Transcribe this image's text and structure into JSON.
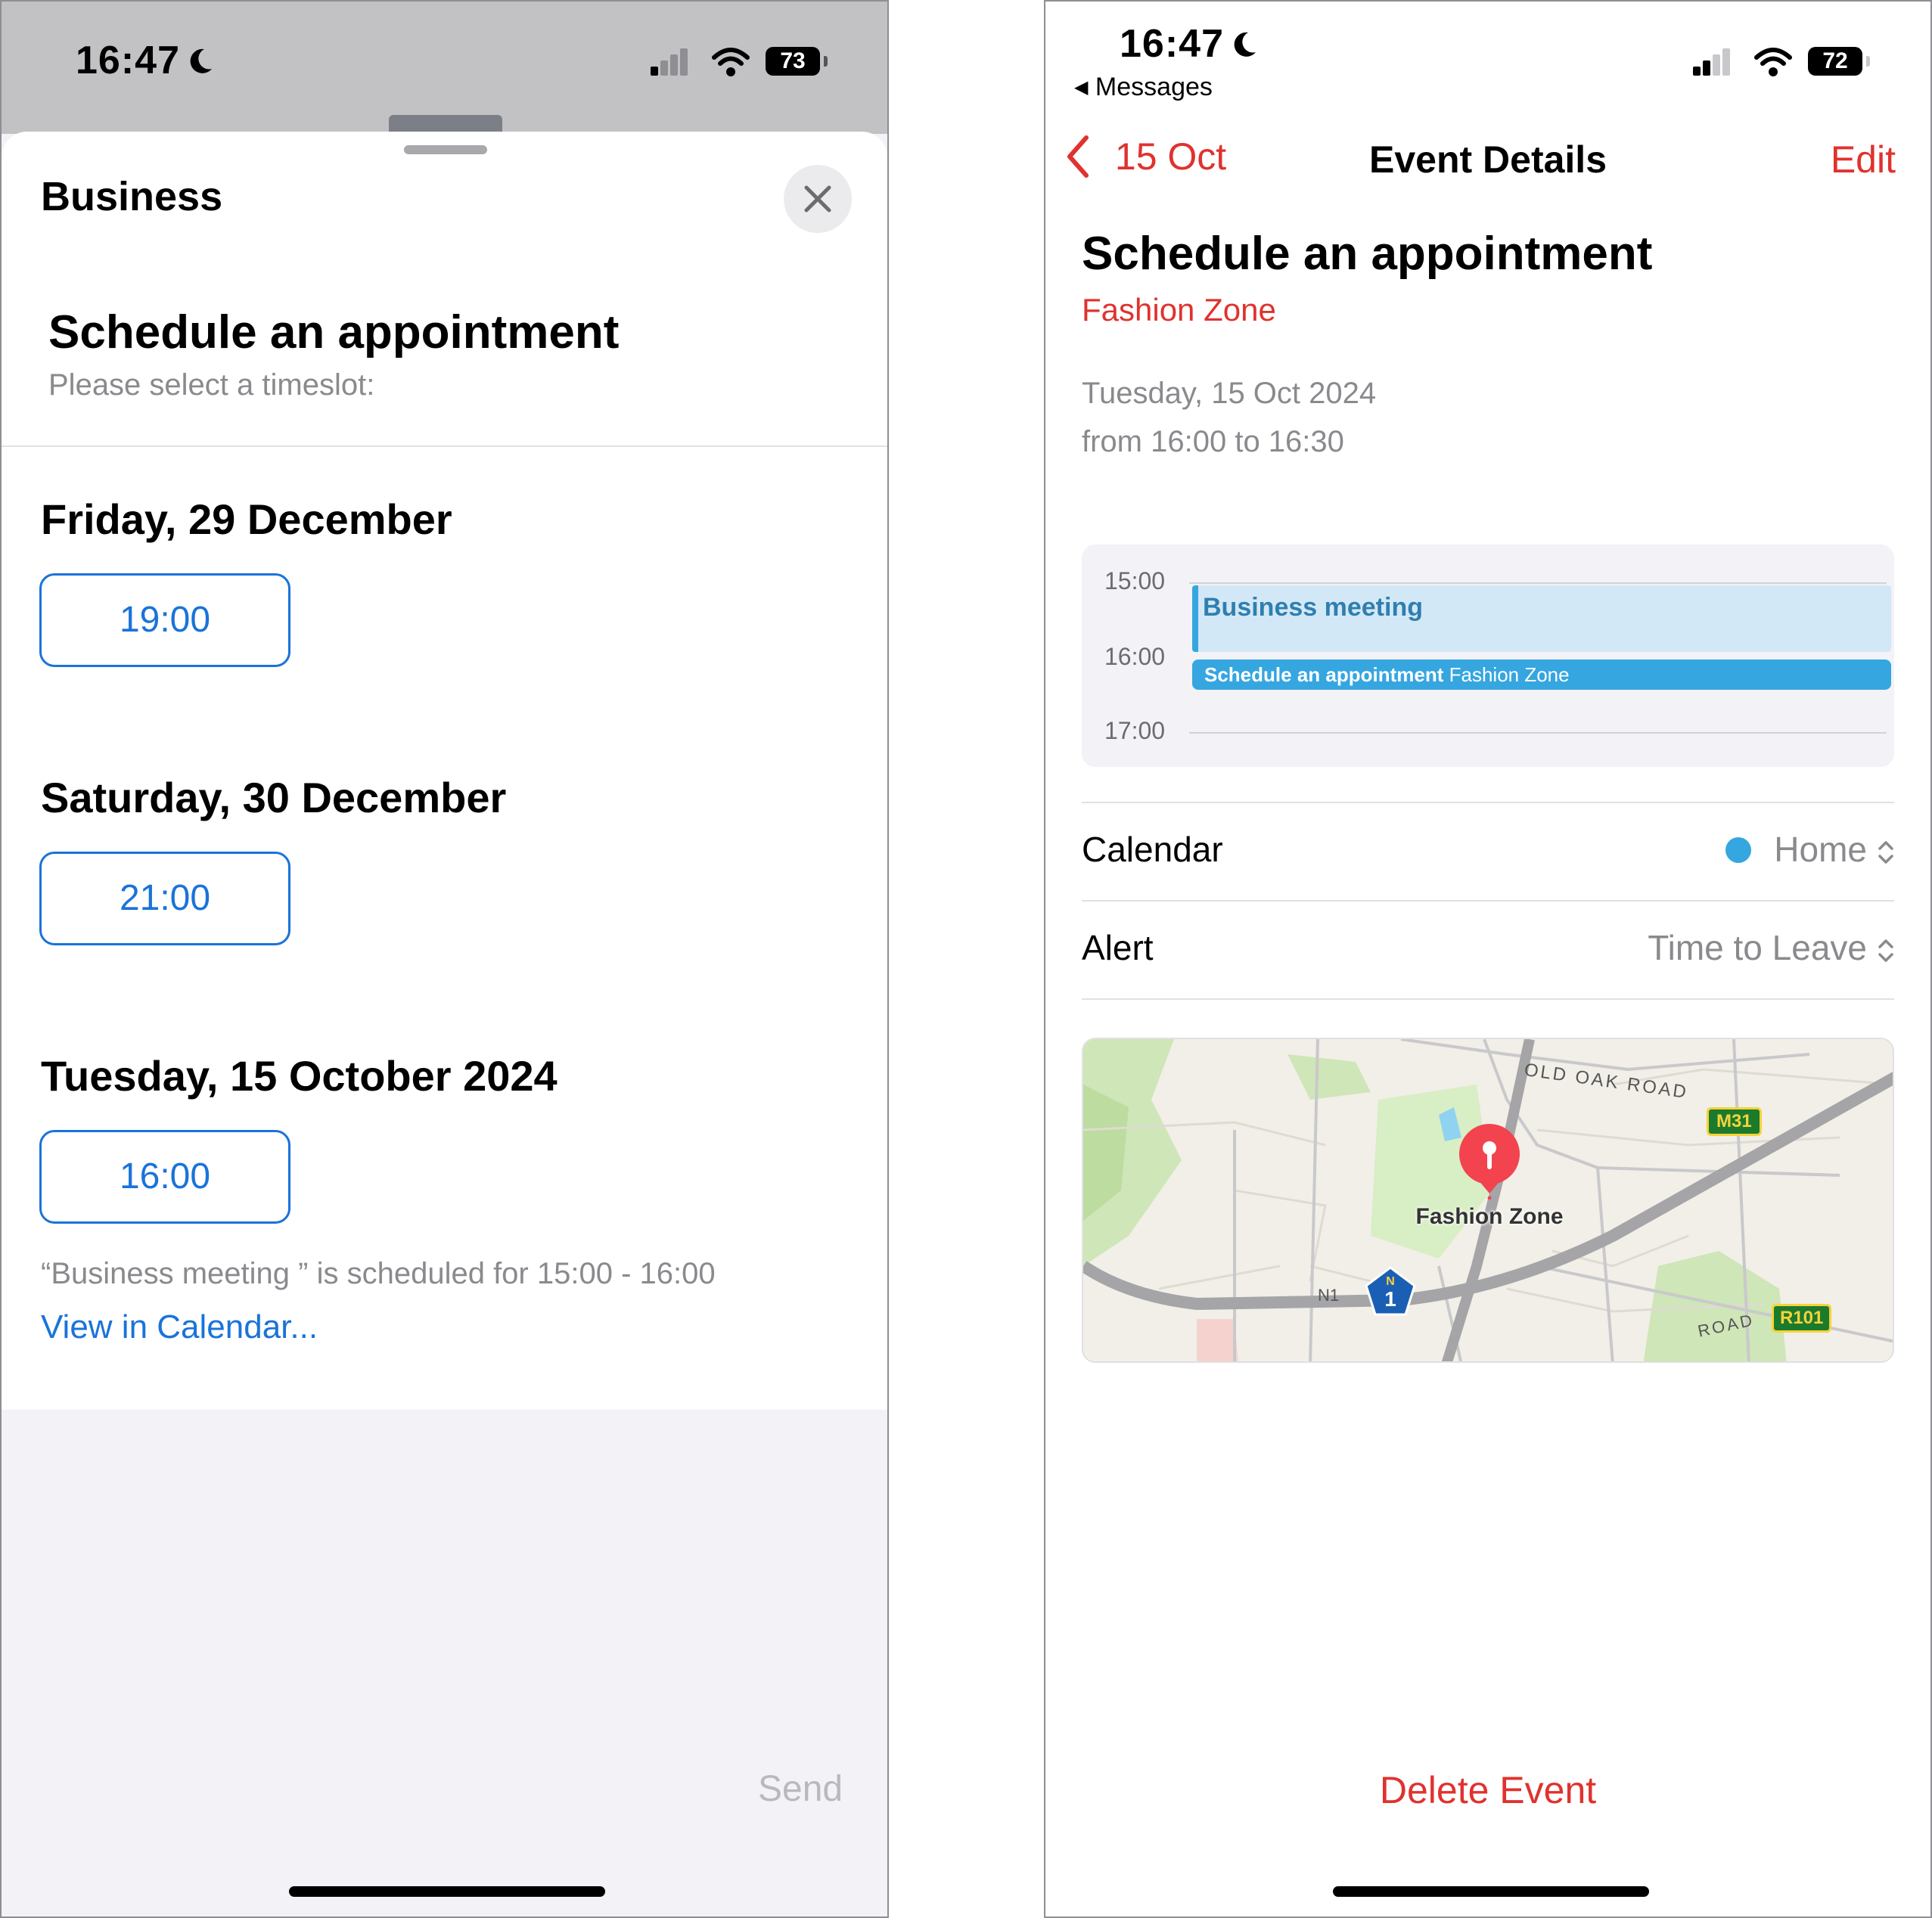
{
  "left": {
    "status": {
      "time": "16:47",
      "battery": "73"
    },
    "sheet_title": "Business",
    "heading": "Schedule an appointment",
    "subtitle": "Please select a timeslot:",
    "days": [
      {
        "label": "Friday, 29 December",
        "slot": "19:00"
      },
      {
        "label": "Saturday, 30 December",
        "slot": "21:00"
      },
      {
        "label": "Tuesday, 15 October 2024",
        "slot": "16:00"
      }
    ],
    "conflict_note": "“Business meeting ” is scheduled for 15:00 - 16:00",
    "view_calendar": "View in Calendar...",
    "send": "Send"
  },
  "right": {
    "status": {
      "time": "16:47",
      "battery": "72",
      "back_app": "Messages"
    },
    "nav": {
      "back_label": "15 Oct",
      "title": "Event Details",
      "edit": "Edit"
    },
    "event_title": "Schedule an appointment",
    "location": "Fashion Zone",
    "date_line": "Tuesday, 15 Oct 2024",
    "time_line": "from 16:00 to 16:30",
    "timeline": {
      "hours": [
        "15:00",
        "16:00",
        "17:00"
      ],
      "meeting": "Business meeting",
      "appointment_title": "Schedule an appointment",
      "appointment_location": "Fashion Zone"
    },
    "calendar": {
      "label": "Calendar",
      "value": "Home",
      "dot_color": "#35a6e0"
    },
    "alert": {
      "label": "Alert",
      "value": "Time to Leave"
    },
    "map": {
      "pin_label": "Fashion Zone",
      "road_old_oak": "OLD OAK ROAD",
      "road_n1": "N1",
      "shield_n1_top": "N",
      "shield_n1_num": "1",
      "shield_m31": "M31",
      "shield_r101": "R101",
      "road_bottom": "ROAD"
    },
    "delete": "Delete Event"
  },
  "colors": {
    "accent_blue": "#1a73d9",
    "accent_red": "#e0322e",
    "event_blue": "#35a6e0"
  }
}
